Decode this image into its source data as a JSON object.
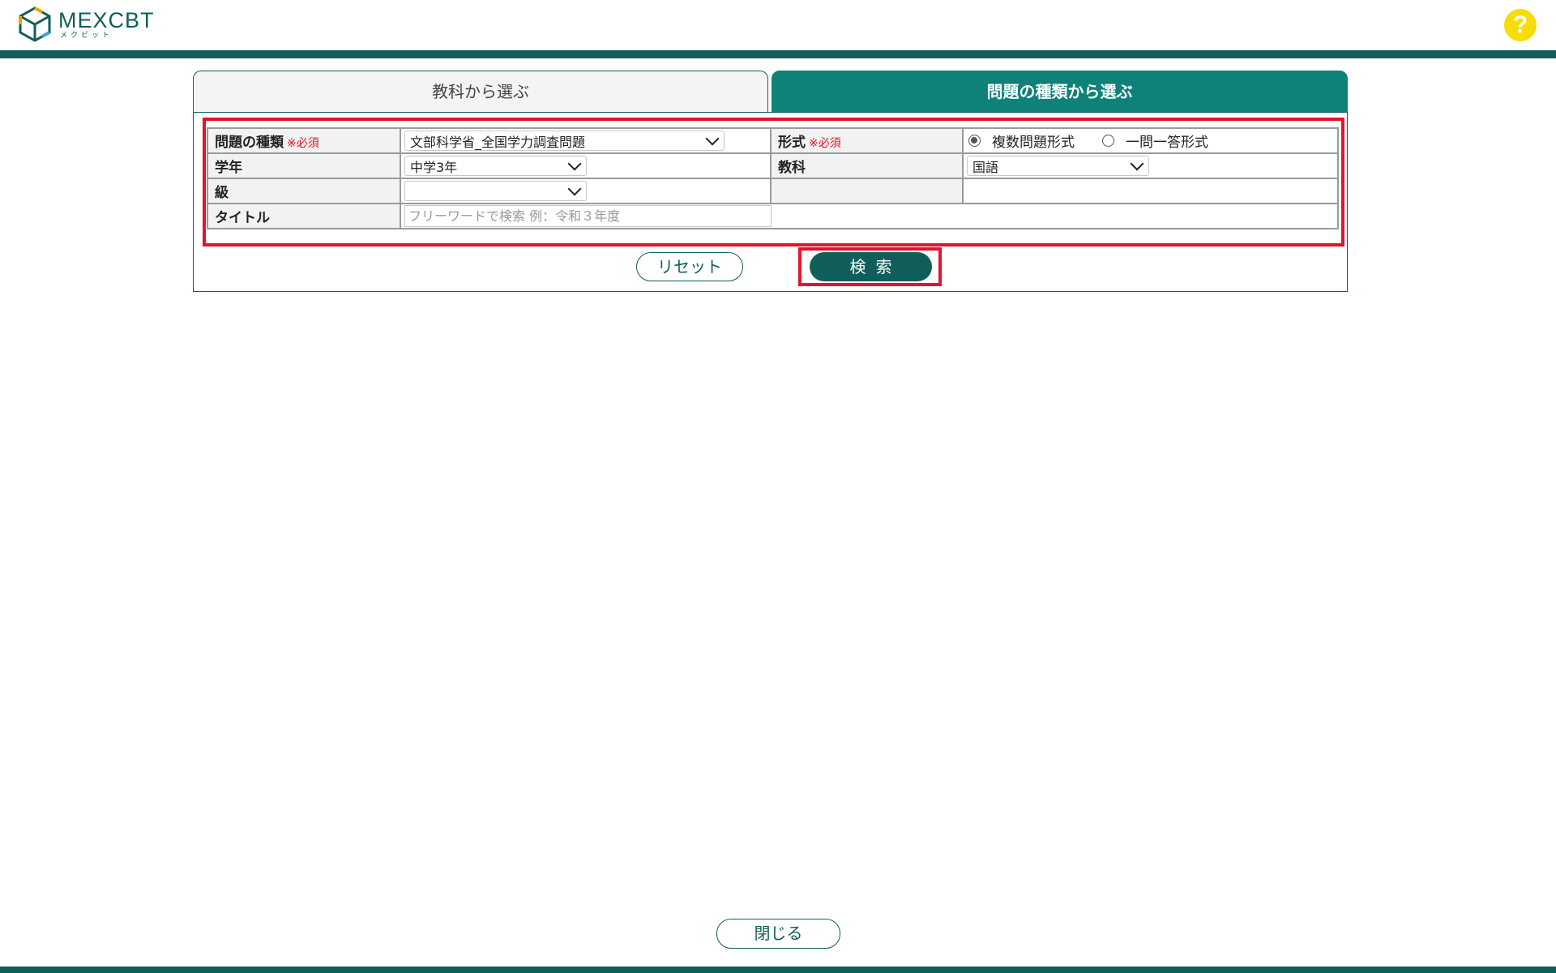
{
  "header": {
    "logo_text": "MEXCBT",
    "logo_sub": "メクビット",
    "help_icon": "?"
  },
  "tabs": [
    {
      "label": "教科から選ぶ",
      "active": false
    },
    {
      "label": "問題の種類から選ぶ",
      "active": true
    }
  ],
  "form": {
    "required_mark": "※必須",
    "problem_type": {
      "label": "問題の種類",
      "value": "文部科学省_全国学力調査問題"
    },
    "format": {
      "label": "形式",
      "options": [
        {
          "label": "複数問題形式",
          "selected": true
        },
        {
          "label": "一問一答形式",
          "selected": false
        }
      ]
    },
    "grade": {
      "label": "学年",
      "value": "中学3年"
    },
    "subject": {
      "label": "教科",
      "value": "国語"
    },
    "level": {
      "label": "級",
      "value": ""
    },
    "title": {
      "label": "タイトル",
      "placeholder": "フリーワードで検索 例：令和３年度"
    }
  },
  "buttons": {
    "reset": "リセット",
    "search": "検索",
    "close": "閉じる"
  },
  "colors": {
    "brand": "#0f5e59",
    "tab_active": "#0e8179",
    "highlight": "#e0142b",
    "help": "#f6dd0a"
  }
}
